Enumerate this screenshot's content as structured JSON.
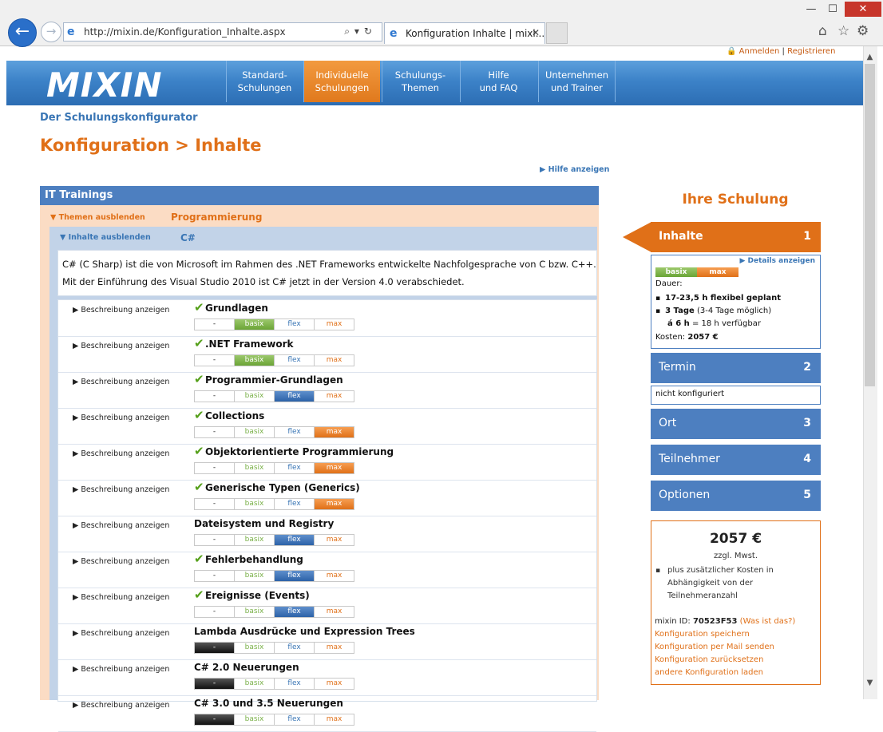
{
  "browser": {
    "url": "http://mixin.de/Konfiguration_Inhalte.aspx",
    "tab_title": "Konfiguration Inhalte | mixi...",
    "ie_glyph": "e",
    "close_glyph": "✕",
    "min_glyph": "—",
    "max_glyph": "☐",
    "back_glyph": "←",
    "fwd_glyph": "→",
    "addr_tools": "⌕▾↻",
    "home_glyph": "⌂",
    "star_glyph": "☆",
    "gear_glyph": "⚙"
  },
  "header": {
    "login": "Anmelden",
    "sep": "|",
    "register": "Registrieren",
    "logo": "MIXIN",
    "nav": [
      {
        "l1": "Standard-",
        "l2": "Schulungen"
      },
      {
        "l1": "Individuelle",
        "l2": "Schulungen"
      },
      {
        "l1": "Schulungs-",
        "l2": "Themen"
      },
      {
        "l1": "Hilfe",
        "l2": "und FAQ"
      },
      {
        "l1": "Unternehmen",
        "l2": "und Trainer"
      }
    ]
  },
  "page": {
    "subtitle": "Der Schulungskonfigurator",
    "title": "Konfiguration > Inhalte",
    "help_link": "▶ Hilfe anzeigen"
  },
  "config": {
    "category": "IT Trainings",
    "theme_toggle": "▼ Themen ausblenden",
    "theme_name": "Programmierung",
    "content_toggle": "▼ Inhalte ausblenden",
    "content_name": "C#",
    "description_l1": "C# (C Sharp) ist die von Microsoft im Rahmen des .NET Frameworks entwickelte Nachfolgesprache von C bzw. C++.",
    "description_l2": "Mit der Einführung des Visual Studio 2010 ist C# jetzt in der Version 4.0 verabschiedet.",
    "show_desc_label": "▶ Beschreibung anzeigen",
    "level_labels": [
      "-",
      "basix",
      "flex",
      "max"
    ],
    "check_glyph": "✔",
    "modules": [
      {
        "name": "Grundlagen",
        "checked": true,
        "level": "basix"
      },
      {
        "name": ".NET Framework",
        "checked": true,
        "level": "basix"
      },
      {
        "name": "Programmier-Grundlagen",
        "checked": true,
        "level": "flex"
      },
      {
        "name": "Collections",
        "checked": true,
        "level": "max"
      },
      {
        "name": "Objektorientierte Programmierung",
        "checked": true,
        "level": "max"
      },
      {
        "name": "Generische Typen (Generics)",
        "checked": true,
        "level": "max"
      },
      {
        "name": "Dateisystem und Registry",
        "checked": false,
        "level": "flex"
      },
      {
        "name": "Fehlerbehandlung",
        "checked": true,
        "level": "flex"
      },
      {
        "name": "Ereignisse (Events)",
        "checked": true,
        "level": "flex"
      },
      {
        "name": "Lambda Ausdrücke und Expression Trees",
        "checked": false,
        "level": "-"
      },
      {
        "name": "C# 2.0 Neuerungen",
        "checked": false,
        "level": "-"
      },
      {
        "name": "C# 3.0 und 3.5 Neuerungen",
        "checked": false,
        "level": "-"
      }
    ]
  },
  "sidebar": {
    "title": "Ihre Schulung",
    "steps": [
      {
        "label": "Inhalte",
        "num": "1"
      },
      {
        "label": "Termin",
        "num": "2"
      },
      {
        "label": "Ort",
        "num": "3"
      },
      {
        "label": "Teilnehmer",
        "num": "4"
      },
      {
        "label": "Optionen",
        "num": "5"
      }
    ],
    "details_link": "▶ Details anzeigen",
    "mini_basix": "basix",
    "mini_max": "max",
    "dauer_label": "Dauer:",
    "dauer_1": "17-23,5 h flexibel geplant",
    "dauer_2_bold": "3 Tage",
    "dauer_2_rest": " (3-4 Tage möglich)",
    "dauer_3_bold": "á 6 h",
    "dauer_3_rest": " = 18 h verfügbar",
    "kosten_label": "Kosten: ",
    "kosten_value": "2057 €",
    "termin_status": "nicht konfiguriert",
    "price": "2057 €",
    "tax": "zzgl. Mwst.",
    "extra_1": "plus zusätzlicher Kosten in",
    "extra_2": "Abhängigkeit von der",
    "extra_3": "Teilnehmeranzahl",
    "mixin_id_label": "mixin ID: ",
    "mixin_id": "70523F53",
    "whatis": " (Was ist das?)",
    "links": [
      "Konfiguration speichern",
      "Konfiguration per Mail senden",
      "Konfiguration zurücksetzen",
      "andere Konfiguration laden"
    ]
  }
}
